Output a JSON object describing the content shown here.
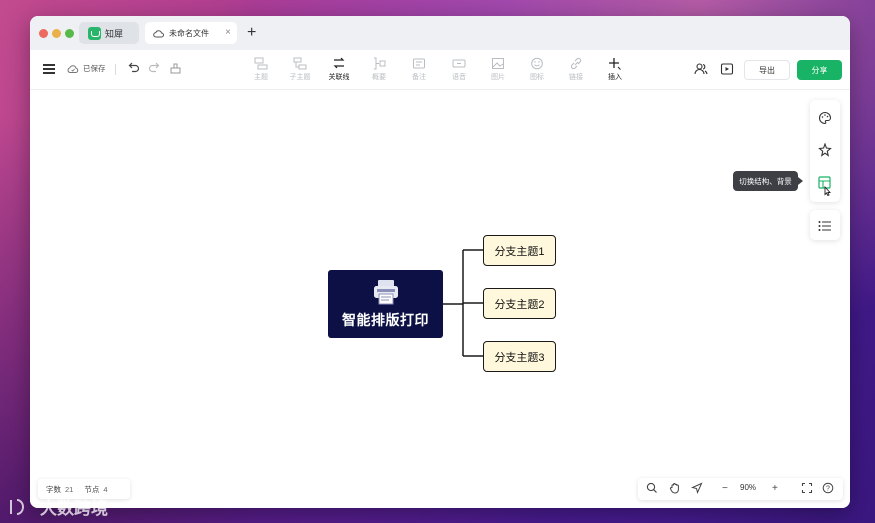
{
  "tabs": {
    "app_name": "知犀",
    "doc_name": "未命名文件",
    "close": "×",
    "new_tab": "+"
  },
  "toolbar": {
    "saved": "已保存",
    "tools": [
      {
        "label": "主题",
        "icon": "topic-icon",
        "active": false
      },
      {
        "label": "子主题",
        "icon": "subtopic-icon",
        "active": false
      },
      {
        "label": "关联线",
        "icon": "relation-line-icon",
        "active": true
      },
      {
        "label": "概要",
        "icon": "summary-icon",
        "active": false
      },
      {
        "label": "备注",
        "icon": "note-icon",
        "active": false
      },
      {
        "label": "语音",
        "icon": "voice-icon",
        "active": false
      },
      {
        "label": "图片",
        "icon": "image-icon",
        "active": false
      },
      {
        "label": "图标",
        "icon": "emoji-icon",
        "active": false
      },
      {
        "label": "链接",
        "icon": "link-icon",
        "active": false
      },
      {
        "label": "插入",
        "icon": "insert-icon",
        "active": true
      }
    ],
    "export_label": "导出",
    "share_label": "分享"
  },
  "mindmap": {
    "central_topic": "智能排版打印",
    "branches": [
      "分支主题1",
      "分支主题2",
      "分支主题3"
    ]
  },
  "side_panel": {
    "tooltip": "切换结构、背景"
  },
  "stats": {
    "word_label": "字数",
    "word_count": "21",
    "node_label": "节点",
    "node_count": "4"
  },
  "zoom": {
    "minus": "−",
    "value": "90%",
    "plus": "+",
    "help": "?"
  },
  "watermark": "大数跨境",
  "colors": {
    "accent_green": "#18b364",
    "central_bg": "#0c1045",
    "branch_bg": "#fff8dc"
  }
}
